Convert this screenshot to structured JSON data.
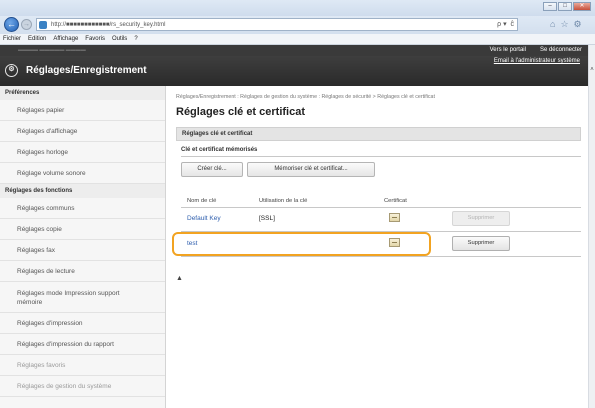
{
  "browser": {
    "url": "http://■■■■■■■■■■■■/rs_security_key.html",
    "url_controls": "ρ ▾  ĉ",
    "menu": [
      "Fichier",
      "Edition",
      "Affichage",
      "Favoris",
      "Outils",
      "?"
    ]
  },
  "header": {
    "title": "Réglages/Enregistrement",
    "portal_link": "Vers le portail",
    "logout_link": "Se déconnecter",
    "admin_link": "Email à l'administrateur système"
  },
  "sidebar": {
    "sections": {
      "preferences": "Préférences",
      "functions": "Réglages des fonctions"
    },
    "items": [
      {
        "label": "Réglages papier"
      },
      {
        "label": "Réglages d'affichage"
      },
      {
        "label": "Réglages horloge"
      },
      {
        "label": "Réglage volume sonore"
      },
      {
        "label": "Réglages communs"
      },
      {
        "label": "Réglages copie"
      },
      {
        "label": "Réglages fax"
      },
      {
        "label": "Réglages de lecture"
      },
      {
        "label": "Réglages mode Impression support mémoire"
      },
      {
        "label": "Réglages d'impression"
      },
      {
        "label": "Réglages d'impression du rapport"
      },
      {
        "label": "Réglages favoris"
      },
      {
        "label": "Réglages de gestion du système"
      }
    ]
  },
  "main": {
    "breadcrumb": "Réglages/Enregistrement : Réglages de gestion du système : Réglages de sécurité > Réglages clé et certificat",
    "title": "Réglages clé et certificat",
    "panel_title": "Réglages clé et certificat",
    "section_title": "Clé et certificat mémorisés",
    "buttons": {
      "create_key": "Créer clé...",
      "register_key": "Mémoriser clé et certificat..."
    },
    "table": {
      "columns": [
        "Nom de clé",
        "Utilisation de la clé",
        "Certificat"
      ],
      "rows": [
        {
          "key_name": "Default Key",
          "usage": "[SSL]",
          "delete_label": "Supprimer",
          "delete_enabled": false
        },
        {
          "key_name": "test",
          "usage": "",
          "delete_label": "Supprimer",
          "delete_enabled": true
        }
      ]
    },
    "to_top": "▲"
  },
  "colors": {
    "header_bg": "#333333",
    "highlight": "#f2a321",
    "link": "#2f5fae"
  }
}
